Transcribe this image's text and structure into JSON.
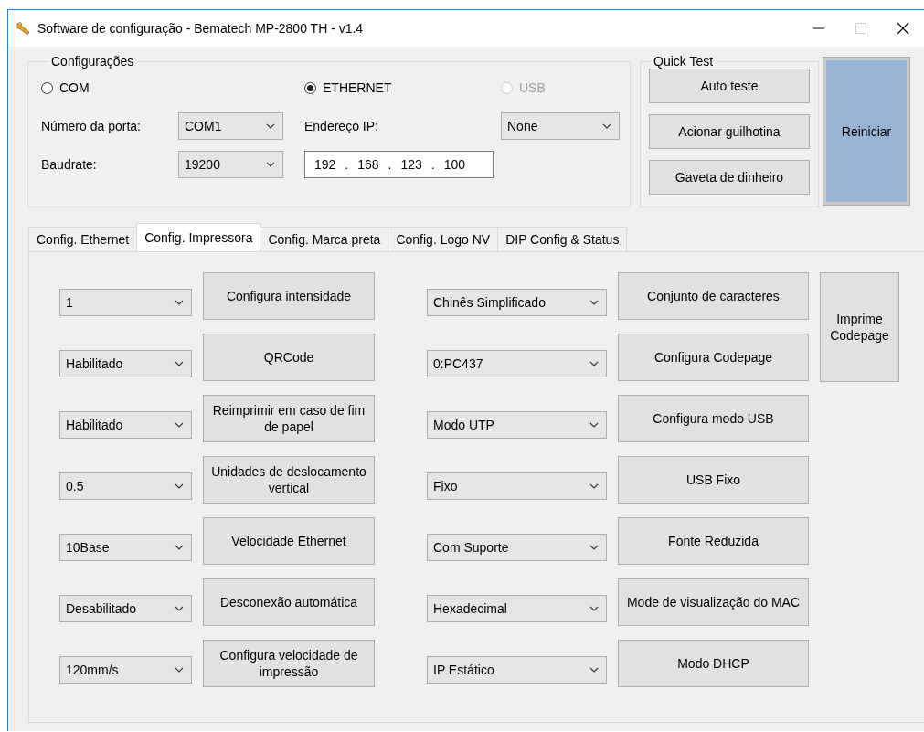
{
  "window": {
    "title": "Software de configuração - Bematech MP-2800 TH - v1.4"
  },
  "configuracoes": {
    "title": "Configurações",
    "connections": [
      {
        "label": "COM",
        "selected": false,
        "disabled": false
      },
      {
        "label": "ETHERNET",
        "selected": true,
        "disabled": false
      },
      {
        "label": "USB",
        "selected": false,
        "disabled": true
      }
    ],
    "port_label": "Número da porta:",
    "port": "COM1",
    "baud_label": "Baudrate:",
    "baudrate": "19200",
    "ip_label": "Endereço IP:",
    "ip_octets": [
      "192",
      "168",
      "123",
      "100"
    ],
    "ip_separator": ".",
    "usb_device": "None"
  },
  "quick_test": {
    "title": "Quick Test",
    "buttons": [
      "Auto teste",
      "Acionar guilhotina",
      "Gaveta de dinheiro"
    ]
  },
  "restart_button": "Reiniciar",
  "tabs": [
    {
      "label": "Config. Ethernet",
      "selected": false
    },
    {
      "label": "Config. Impressora",
      "selected": true
    },
    {
      "label": "Config. Marca preta",
      "selected": false
    },
    {
      "label": "Config. Logo NV",
      "selected": false
    },
    {
      "label": "DIP Config & Status",
      "selected": false
    }
  ],
  "rows": [
    {
      "left_value": "1",
      "left_button": "Configura intensidade",
      "right_value": "Chinês Simplificado",
      "right_button": "Conjunto de caracteres"
    },
    {
      "left_value": "Habilitado",
      "left_button": "QRCode",
      "right_value": "0:PC437",
      "right_button": "Configura Codepage"
    },
    {
      "left_value": "Habilitado",
      "left_button": "Reimprimir em caso de fim de papel",
      "right_value": "Modo UTP",
      "right_button": "Configura modo USB"
    },
    {
      "left_value": "0.5",
      "left_button": "Unidades de deslocamento vertical",
      "right_value": "Fixo",
      "right_button": "USB Fixo"
    },
    {
      "left_value": "10Base",
      "left_button": "Velocidade Ethernet",
      "right_value": "Com Suporte",
      "right_button": "Fonte Reduzida"
    },
    {
      "left_value": "Desabilitado",
      "left_button": "Desconexão automática",
      "right_value": "Hexadecimal",
      "right_button": "Mode de visualização do MAC"
    },
    {
      "left_value": "120mm/s",
      "left_button": "Configura velocidade de impressão",
      "right_value": "IP Estático",
      "right_button": "Modo DHCP"
    }
  ],
  "print_codepage_button": "Imprime Codepage"
}
